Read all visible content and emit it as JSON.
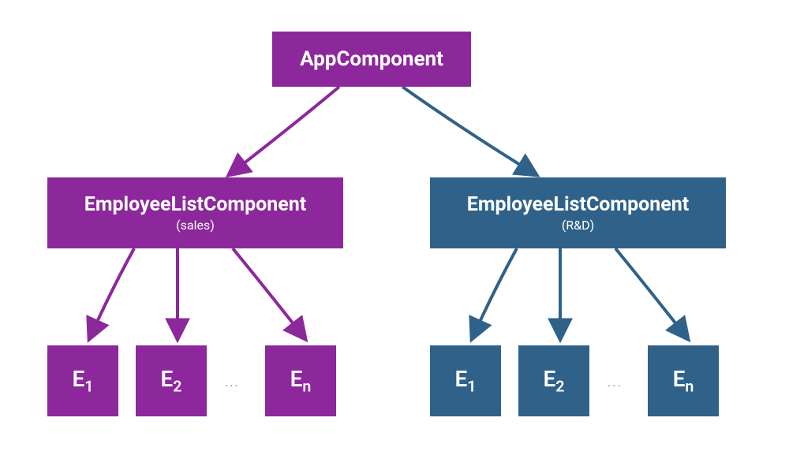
{
  "colors": {
    "purple": "#8c289b",
    "blue": "#306289"
  },
  "root": {
    "title": "AppComponent"
  },
  "left": {
    "title": "EmployeeListComponent",
    "sub": "(sales)",
    "leaves": {
      "e1": "E",
      "e1sub": "1",
      "e2": "E",
      "e2sub": "2",
      "ell": "...",
      "en": "E",
      "ensub": "n"
    }
  },
  "right": {
    "title": "EmployeeListComponent",
    "sub": "(R&D)",
    "leaves": {
      "e1": "E",
      "e1sub": "1",
      "e2": "E",
      "e2sub": "2",
      "ell": "...",
      "en": "E",
      "ensub": "n"
    }
  }
}
